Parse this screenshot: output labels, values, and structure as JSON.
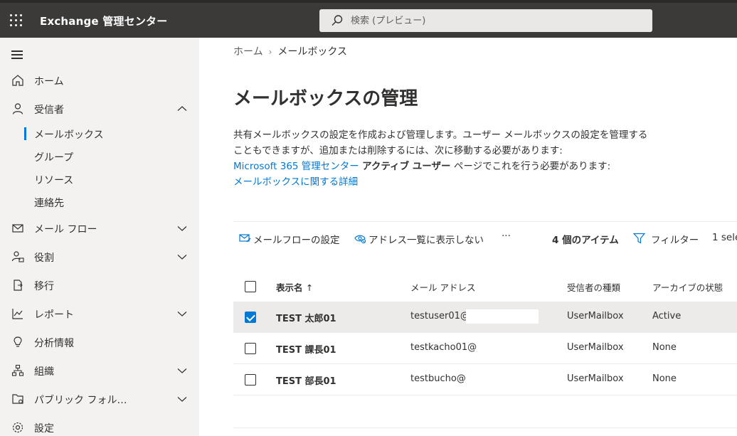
{
  "header": {
    "app_title": "Exchange 管理センター",
    "search_placeholder": "検索 (プレビュー)"
  },
  "sidebar": {
    "items": [
      {
        "label": "ホーム"
      },
      {
        "label": "受信者"
      },
      {
        "label": "メール フロー"
      },
      {
        "label": "役割"
      },
      {
        "label": "移行"
      },
      {
        "label": "レポート"
      },
      {
        "label": "分析情報"
      },
      {
        "label": "組織"
      },
      {
        "label": "パブリック フォル…"
      },
      {
        "label": "設定"
      }
    ],
    "recipients_sub": [
      {
        "label": "メールボックス",
        "active": true
      },
      {
        "label": "グループ"
      },
      {
        "label": "リソース"
      },
      {
        "label": "連絡先"
      }
    ]
  },
  "breadcrumb": {
    "home": "ホーム",
    "separator": "›",
    "current": "メールボックス"
  },
  "page": {
    "title": "メールボックスの管理",
    "desc_line1": "共有メールボックスの設定を作成および管理します。ユーザー メールボックスの設定を管理する",
    "desc_line2": "こともできますが、追加または削除するには、次に移動する必要があります:",
    "desc_link": "Microsoft 365 管理センター",
    "desc_bold": "アクティブ ユーザー",
    "desc_tail": "ページでこれを行う必要があります:",
    "learn_more": "メールボックスに関する詳細"
  },
  "commands": {
    "mailflow": "メールフローの設定",
    "hide_gal": "アドレス一覧に表示しない",
    "more": "···",
    "count": "4 個のアイテム",
    "filter": "フィルター",
    "selected": "1 sele"
  },
  "table": {
    "headers": {
      "name": "表示名",
      "sort": "↑",
      "email": "メール アドレス",
      "type": "受信者の種類",
      "archive": "アーカイブの状態"
    },
    "rows": [
      {
        "name": "TEST 太郎01",
        "email": "testuser01@r",
        "type": "UserMailbox",
        "archive": "Active",
        "checked": true
      },
      {
        "name": "TEST 課長01",
        "email": "testkacho01@",
        "type": "UserMailbox",
        "archive": "None",
        "checked": false
      },
      {
        "name": "TEST 部長01",
        "email": "testbucho@",
        "type": "UserMailbox",
        "archive": "None",
        "checked": false
      }
    ]
  },
  "colors": {
    "topbar": "#3b3a39",
    "sidebar": "#f3f2f1",
    "accent": "#0078d4",
    "selected_row": "#edebe9"
  }
}
